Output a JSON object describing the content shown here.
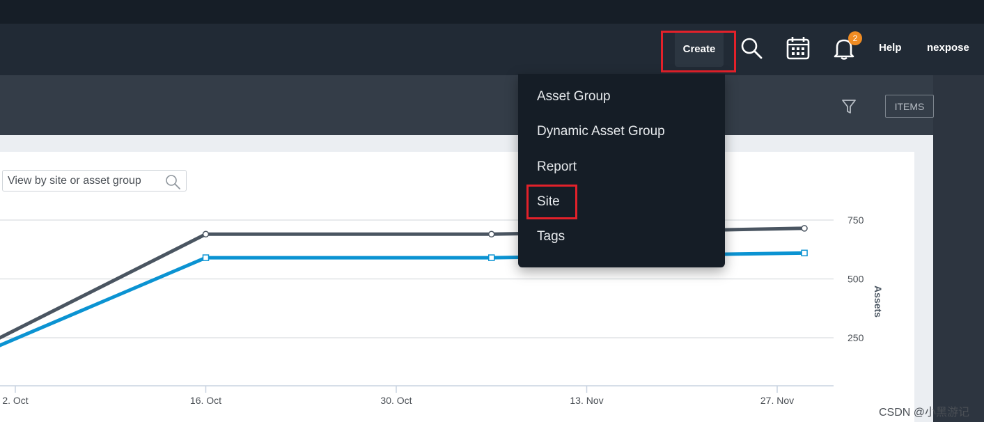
{
  "header": {
    "create_label": "Create",
    "help_label": "Help",
    "user_label": "nexpose",
    "notification_count": "2"
  },
  "toolbar": {
    "items_label": "ITEMS"
  },
  "search": {
    "placeholder": "View by site or asset group"
  },
  "create_menu": {
    "items": [
      {
        "label": "Asset Group"
      },
      {
        "label": "Dynamic Asset Group"
      },
      {
        "label": "Report"
      },
      {
        "label": "Site"
      },
      {
        "label": "Tags"
      }
    ],
    "highlighted": "Site"
  },
  "chart_data": {
    "type": "line",
    "x_tick_labels": [
      "2. Oct",
      "16. Oct",
      "30. Oct",
      "13. Nov",
      "27. Nov"
    ],
    "y_tick_labels": [
      "250",
      "500",
      "750"
    ],
    "ylabel": "Assets",
    "series": [
      {
        "values": [
          {
            "x": "2023-10-02",
            "y": 250
          },
          {
            "x": "2023-10-16",
            "y": 690
          },
          {
            "x": "2023-11-06",
            "y": 690
          },
          {
            "x": "2023-11-29",
            "y": 715
          }
        ],
        "color": "#4a5561"
      },
      {
        "values": [
          {
            "x": "2023-10-02",
            "y": 220
          },
          {
            "x": "2023-10-16",
            "y": 590
          },
          {
            "x": "2023-11-06",
            "y": 590
          },
          {
            "x": "2023-11-29",
            "y": 610
          }
        ],
        "color": "#0b93d2"
      }
    ]
  },
  "watermark": "CSDN @小黑游记",
  "colors": {
    "highlight": "#e3212a",
    "badge": "#f08c23",
    "series_dark": "#4a5561",
    "series_blue": "#0b93d2"
  }
}
